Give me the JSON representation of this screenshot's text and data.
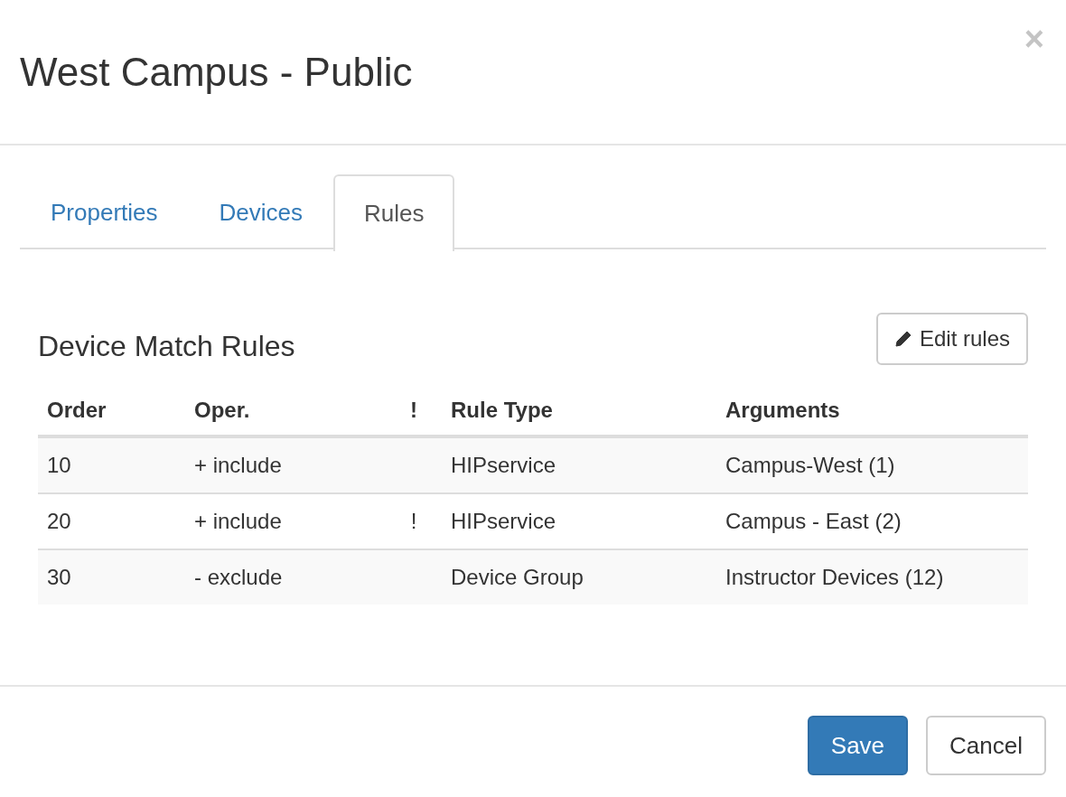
{
  "dialog": {
    "title": "West Campus - Public",
    "close": "×"
  },
  "tabs": [
    {
      "label": "Properties",
      "selected": false
    },
    {
      "label": "Devices",
      "selected": false
    },
    {
      "label": "Rules",
      "selected": true
    }
  ],
  "section": {
    "title": "Device Match Rules",
    "edit_button": "Edit rules"
  },
  "table": {
    "columns": [
      "Order",
      "Oper.",
      "!",
      "Rule Type",
      "Arguments"
    ],
    "rows": [
      {
        "order": "10",
        "oper": "+ include",
        "rule_type": "HIPservice",
        "arguments": "Campus-West (1)"
      },
      {
        "order": "20",
        "oper": "+ include",
        "not": "!",
        "rule_type": "HIPservice",
        "arguments": "Campus - East (2)"
      },
      {
        "order": "30",
        "oper": "- exclude",
        "rule_type": "Device Group",
        "arguments": "Instructor Devices (12)"
      }
    ]
  },
  "footer": {
    "buttons": [
      {
        "label": "Save",
        "kind": "primary"
      },
      {
        "label": "Cancel",
        "kind": "default"
      }
    ]
  }
}
